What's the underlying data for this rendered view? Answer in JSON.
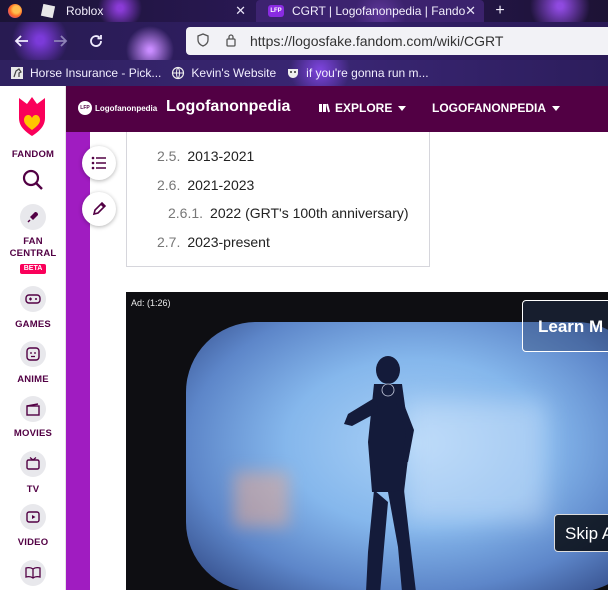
{
  "browser": {
    "tabs": [
      {
        "title": "Roblox",
        "close": "✕"
      },
      {
        "title": "CGRT | Logofanonpedia | Fando",
        "close": "✕",
        "favicon": "LFP"
      }
    ],
    "new_tab": "+",
    "url": "https://logosfake.fandom.com/wiki/CGRT",
    "bookmarks": [
      {
        "label": "Horse Insurance - Pick...",
        "icon": "horse-icon"
      },
      {
        "label": "Kevin's Website",
        "icon": "globe-icon"
      },
      {
        "label": "if you're gonna run m...",
        "icon": "mask-icon"
      }
    ]
  },
  "fandom_rail": {
    "logo_text": "FANDOM",
    "items": [
      {
        "label": "FAN\nCENTRAL",
        "icon": "rocket-icon",
        "badge": "BETA"
      },
      {
        "label": "GAMES",
        "icon": "controller-icon"
      },
      {
        "label": "ANIME",
        "icon": "face-icon"
      },
      {
        "label": "MOVIES",
        "icon": "clapper-icon"
      },
      {
        "label": "TV",
        "icon": "tv-icon"
      },
      {
        "label": "VIDEO",
        "icon": "play-icon"
      }
    ]
  },
  "wiki": {
    "mini_logo": "Logofanonpedia",
    "mini_badge": "LFP",
    "title": "Logofanonpedia",
    "menu": [
      {
        "label": "EXPLORE"
      },
      {
        "label": "LOGOFANONPEDIA"
      }
    ]
  },
  "toc": {
    "items": [
      {
        "num": "2.5.",
        "text": "2013-2021"
      },
      {
        "num": "2.6.",
        "text": "2021-2023"
      },
      {
        "num": "2.6.1.",
        "text": "2022 (GRT's 100th anniversary)"
      },
      {
        "num": "2.7.",
        "text": "2023-present"
      }
    ]
  },
  "ad": {
    "label": "Ad: (1:26)",
    "learn_more": "Learn M",
    "skip": "Skip A"
  }
}
